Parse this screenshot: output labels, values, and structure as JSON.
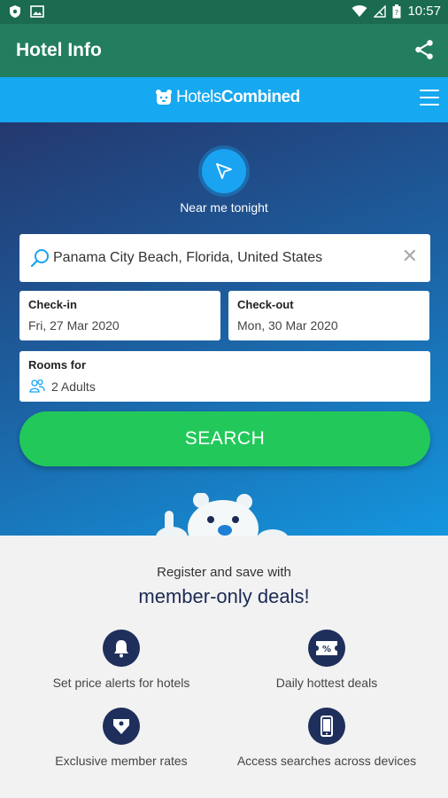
{
  "status_bar": {
    "time": "10:57"
  },
  "app_bar": {
    "title": "Hotel Info"
  },
  "brand": {
    "name_light": "Hotels",
    "name_bold": "Combined"
  },
  "hero": {
    "near_me_label": "Near me tonight",
    "destination": "Panama City Beach, Florida, United States",
    "checkin": {
      "label": "Check-in",
      "value": "Fri, 27 Mar 2020"
    },
    "checkout": {
      "label": "Check-out",
      "value": "Mon, 30 Mar 2020"
    },
    "rooms": {
      "label": "Rooms for",
      "value": "2 Adults"
    },
    "search_label": "SEARCH"
  },
  "register": {
    "line1": "Register and save with",
    "line2": "member-only deals!",
    "features": [
      {
        "icon": "bell-icon",
        "text": "Set price alerts for hotels"
      },
      {
        "icon": "ticket-icon",
        "text": "Daily hottest deals"
      },
      {
        "icon": "tag-icon",
        "text": "Exclusive member rates"
      },
      {
        "icon": "phone-icon",
        "text": "Access searches across devices"
      }
    ]
  },
  "colors": {
    "status_bar": "#1a6b4f",
    "app_bar": "#237e5f",
    "brand_bar": "#16a8f0",
    "search_button": "#22c95a",
    "navy": "#1f2f5c"
  }
}
